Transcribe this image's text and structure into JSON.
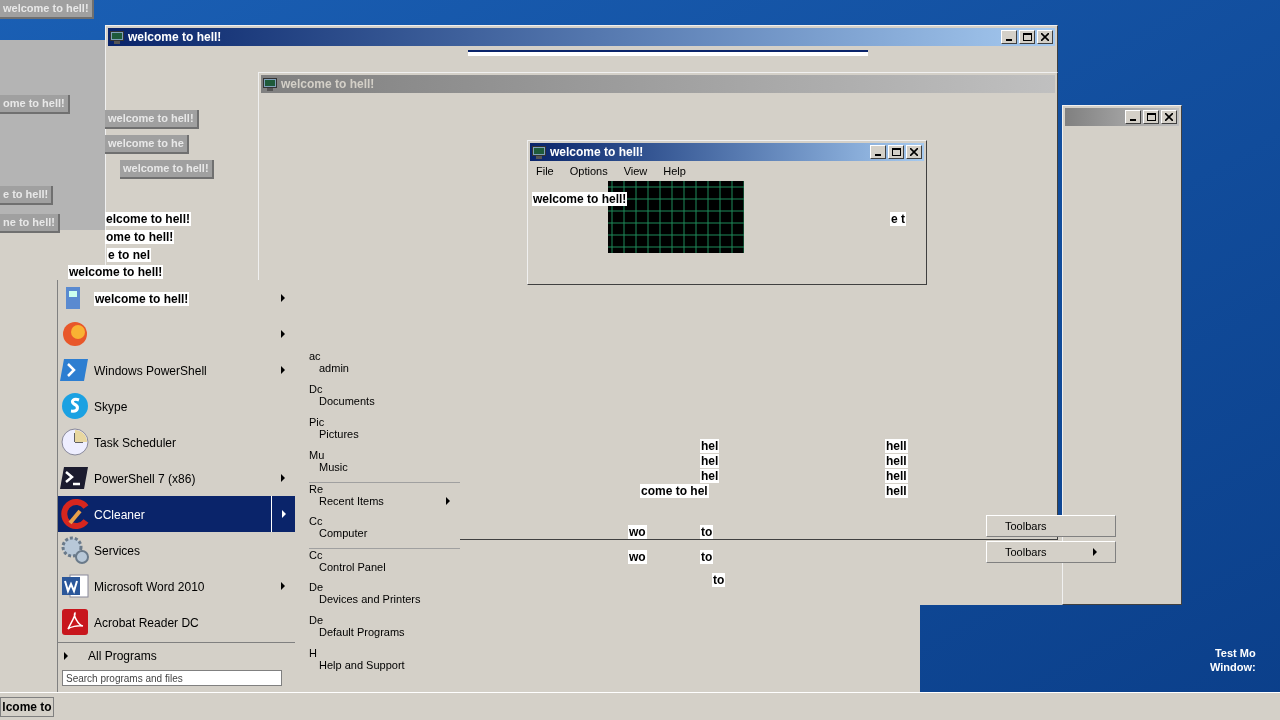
{
  "ghost_labels": [
    "welcome to hell!",
    "ome to hell!",
    "welcome to hell!",
    "welcome to he",
    "e to hell!",
    "ne to hell!",
    "welcome to hell!"
  ],
  "windows": [
    {
      "title": "welcome to hell!",
      "active": true
    },
    {
      "title": "welcome to hell!",
      "active": false
    },
    {
      "title": "welcome to hell!",
      "active": true,
      "menu": [
        "File",
        "Options",
        "View",
        "Help"
      ]
    },
    {
      "active": false
    }
  ],
  "fragments": [
    "elcome to hell!",
    "ome to hell!",
    "e to nel",
    "welcome to hell!",
    "welcome to hell!",
    "e t",
    "hel",
    "hel",
    "hel",
    "come to hel",
    "hell",
    "hell",
    "hell",
    "hell",
    "wo",
    "to",
    "wo",
    "to",
    "to"
  ],
  "start_menu": {
    "programs": [
      {
        "label": "welcome to hell!",
        "submenu": true,
        "selected": false
      },
      {
        "submenu": true,
        "selected": false
      },
      {
        "label": "Windows PowerShell",
        "submenu": true,
        "selected": false
      },
      {
        "label": "Skype",
        "submenu": false,
        "selected": false
      },
      {
        "label": "Task Scheduler",
        "submenu": false,
        "selected": false
      },
      {
        "label": "PowerShell 7 (x86)",
        "submenu": true,
        "selected": false
      },
      {
        "label": "CCleaner",
        "submenu": true,
        "selected": true
      },
      {
        "label": "Services",
        "submenu": false,
        "selected": false
      },
      {
        "label": "Microsoft Word 2010",
        "submenu": true,
        "selected": false
      },
      {
        "label": "Acrobat Reader DC",
        "submenu": false,
        "selected": false
      }
    ],
    "all_programs": "All Programs",
    "search": {
      "placeholder": "Search programs and files"
    },
    "places": [
      {
        "ghost": "ac",
        "label": "admin",
        "submenu": false
      },
      {
        "ghost": "Dc",
        "label": "Documents",
        "submenu": false
      },
      {
        "ghost": "Pic",
        "label": "Pictures",
        "submenu": false
      },
      {
        "ghost": "Mu",
        "label": "Music",
        "submenu": false
      },
      {
        "ghost": "Re",
        "label": "Recent Items",
        "submenu": true
      },
      {
        "ghost": "Cc",
        "label": "Computer",
        "submenu": false
      },
      {
        "ghost": "Cc",
        "label": "Control Panel",
        "submenu": false
      },
      {
        "ghost": "De",
        "label": "Devices and Printers",
        "submenu": false
      },
      {
        "ghost": "De",
        "label": "Default Programs",
        "submenu": false
      },
      {
        "ghost": "H",
        "label": "Help and Support",
        "submenu": false
      }
    ]
  },
  "context_menu": [
    {
      "label": "Toolbars",
      "submenu": false
    },
    {
      "label": "Toolbars",
      "submenu": true
    }
  ],
  "taskbar": {
    "button": "lcome to"
  },
  "test_mode": [
    "Test Mo",
    "Window:"
  ]
}
